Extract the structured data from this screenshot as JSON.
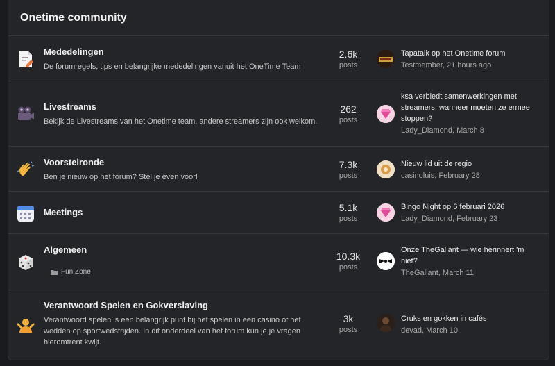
{
  "header": {
    "title": "Onetime community"
  },
  "forums": [
    {
      "title": "Mededelingen",
      "description": "De forumregels, tips en belangrijke mededelingen vanuit het OneTime Team",
      "count": "2.6k",
      "count_label": "posts",
      "latest_title": "Tapatalk op het Onetime forum",
      "latest_meta": "Testmember, 21 hours ago",
      "icon": "document-pencil-icon"
    },
    {
      "title": "Livestreams",
      "description": "Bekijk de Livestreams van het Onetime team, andere streamers zijn ook welkom.",
      "count": "262",
      "count_label": "posts",
      "latest_title": "ksa verbiedt samenwerkingen met streamers: wanneer moeten ze ermee stoppen?",
      "latest_meta": "Lady_Diamond, March 8",
      "icon": "video-camera-icon"
    },
    {
      "title": "Voorstelronde",
      "description": "Ben je nieuw op het forum? Stel je even voor!",
      "count": "7.3k",
      "count_label": "posts",
      "latest_title": "Nieuw lid uit de regio",
      "latest_meta": "casinoluis, February 28",
      "icon": "waving-hand-icon"
    },
    {
      "title": "Meetings",
      "description": "",
      "count": "5.1k",
      "count_label": "posts",
      "latest_title": "Bingo Night op 6 februari 2026",
      "latest_meta": "Lady_Diamond, February 23",
      "icon": "calendar-icon"
    },
    {
      "title": "Algemeen",
      "description": "",
      "subforum": "Fun Zone",
      "count": "10.3k",
      "count_label": "posts",
      "latest_title": "Onze TheGallant — wie herinnert 'm niet?",
      "latest_meta": "TheGallant, March 11",
      "icon": "dice-icon"
    },
    {
      "title": "Verantwoord Spelen en Gokverslaving",
      "description": "Verantwoord spelen is een belangrijk punt bij het spelen in een casino of het wedden op sportwedstrijden. In dit onderdeel van het forum kun je je vragen hieromtrent kwijt.",
      "count": "3k",
      "count_label": "posts",
      "latest_title": "Cruks en gokken in cafés",
      "latest_meta": "devad, March 10",
      "icon": "person-shrugging-icon"
    }
  ]
}
